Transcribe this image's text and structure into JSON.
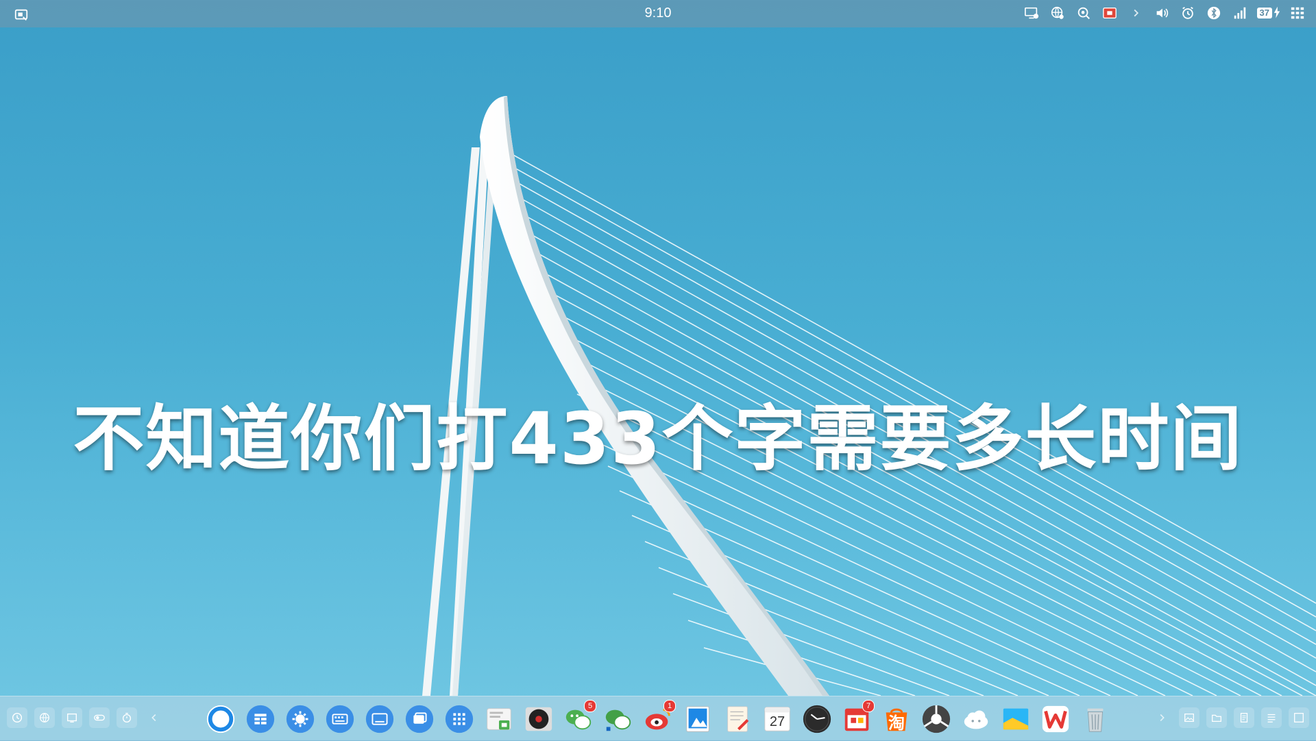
{
  "status_bar": {
    "time": "9:10",
    "battery_level": "37",
    "left_icon": "screen-switch-icon",
    "right_icons": [
      "cast-screen-icon",
      "globe-settings-icon",
      "search-icon",
      "screen-record-icon",
      "chevron-right-icon",
      "volume-icon",
      "alarm-icon",
      "bluetooth-icon",
      "signal-icon",
      "battery-icon",
      "app-grid-icon"
    ]
  },
  "wallpaper": {
    "headline": "不知道你们打433个字需要多长时间",
    "sky_top": "#3a9ec8",
    "sky_bottom": "#72c8e3"
  },
  "dock": {
    "left_tools": [
      "clock-tool-icon",
      "globe-tool-icon",
      "window-tool-icon",
      "toggle-tool-icon",
      "timer-tool-icon",
      "chevron-left-icon"
    ],
    "apps": [
      {
        "name": "browser-app",
        "badge": ""
      },
      {
        "name": "files-app",
        "badge": ""
      },
      {
        "name": "settings-app",
        "badge": ""
      },
      {
        "name": "keyboard-app",
        "badge": ""
      },
      {
        "name": "screen-keyboard-app",
        "badge": ""
      },
      {
        "name": "window-app",
        "badge": ""
      },
      {
        "name": "app-launcher",
        "badge": ""
      },
      {
        "name": "file-manager-app",
        "badge": ""
      },
      {
        "name": "music-player-app",
        "badge": ""
      },
      {
        "name": "wechat-app",
        "badge": "5"
      },
      {
        "name": "wechat-work-app",
        "badge": ""
      },
      {
        "name": "weibo-app",
        "badge": "1"
      },
      {
        "name": "photo-app",
        "badge": ""
      },
      {
        "name": "notes-app",
        "badge": ""
      },
      {
        "name": "calendar-app",
        "badge": "",
        "day": "27"
      },
      {
        "name": "clock-app",
        "badge": ""
      },
      {
        "name": "store-app",
        "badge": "7"
      },
      {
        "name": "taobao-app",
        "badge": "",
        "label": "淘"
      },
      {
        "name": "chrome-like-app",
        "badge": ""
      },
      {
        "name": "cloud-app",
        "badge": ""
      },
      {
        "name": "gallery-app",
        "badge": ""
      },
      {
        "name": "wps-app",
        "badge": ""
      },
      {
        "name": "trash-app",
        "badge": ""
      }
    ],
    "right_tools": [
      "chevron-right-icon",
      "image-tool-icon",
      "folder-tool-icon",
      "doc-tool-icon",
      "list-tool-icon",
      "fullscreen-tool-icon"
    ]
  }
}
